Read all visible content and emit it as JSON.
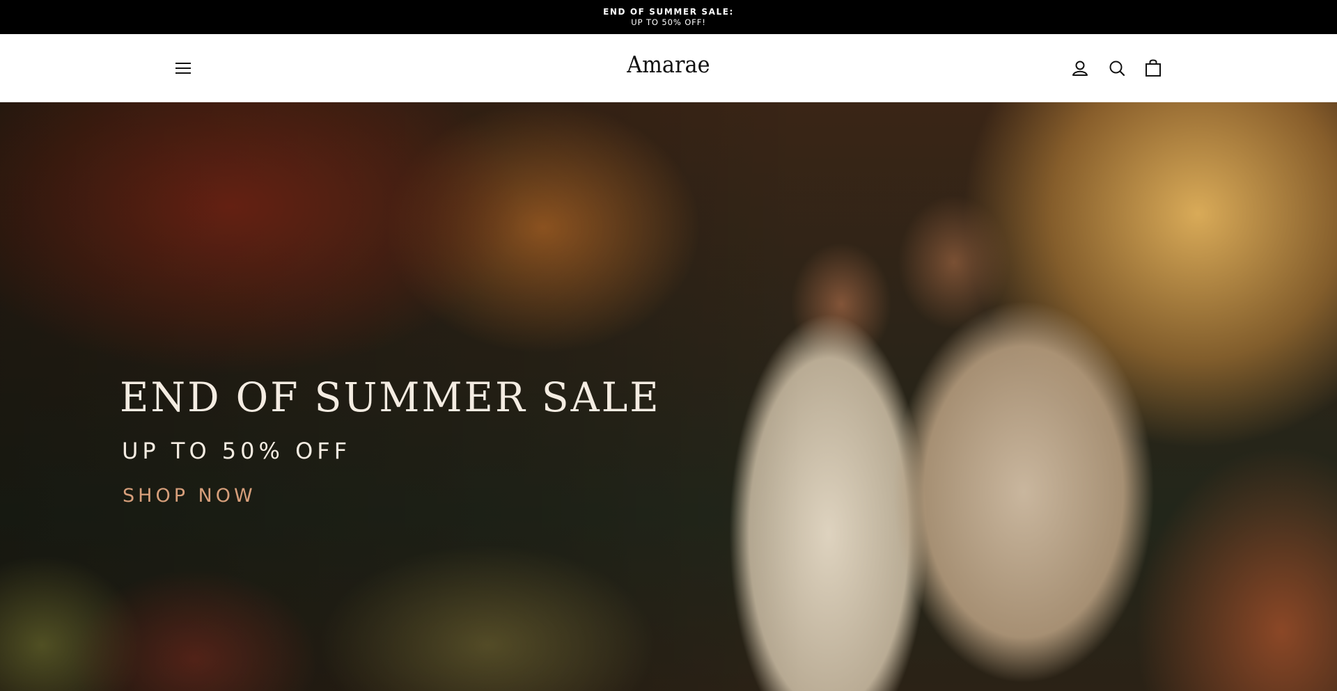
{
  "announcement": {
    "line1": "END OF SUMMER SALE:",
    "line2": "UP TO 50% OFF!"
  },
  "header": {
    "brand": "Amarae",
    "icons": [
      "menu-icon",
      "account-icon",
      "search-icon",
      "cart-icon"
    ]
  },
  "hero": {
    "title": "END OF SUMMER SALE",
    "subtitle": "UP TO 50% OFF",
    "cta": "SHOP NOW"
  },
  "colors": {
    "announcement_bg": "#000000",
    "hero_text": "#f4ece2",
    "cta": "#d79f7b"
  }
}
